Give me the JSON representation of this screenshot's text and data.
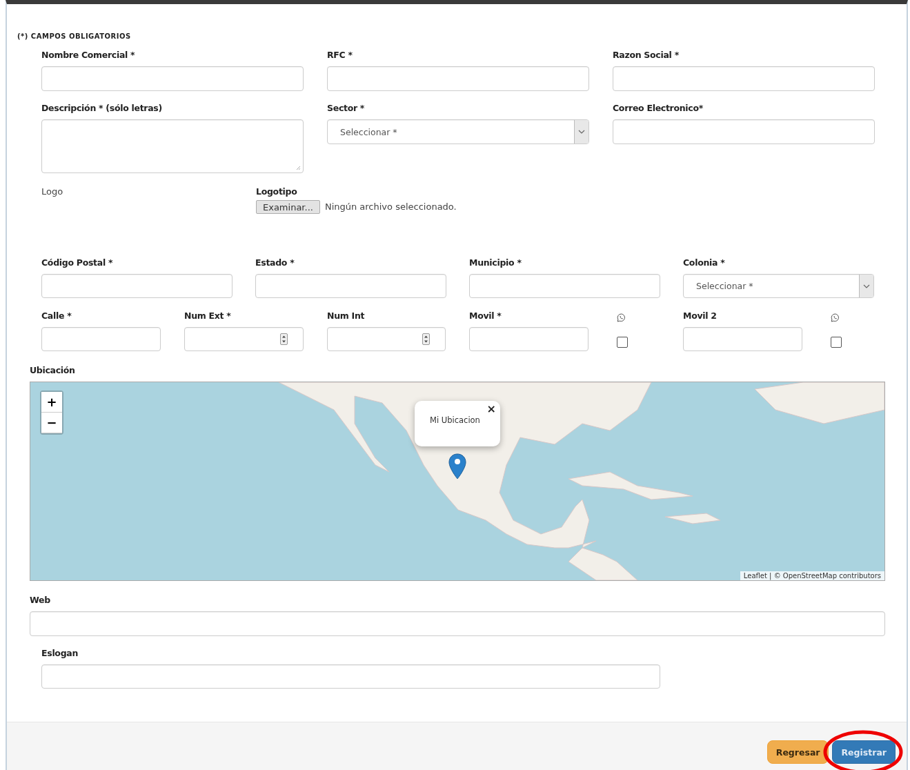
{
  "required_note": "(*) CAMPOS OBLIGATORIOS",
  "row_1": [
    {
      "label": "Nombre Comercial *",
      "kind": "text"
    },
    {
      "label": "RFC *",
      "kind": "text"
    },
    {
      "label": "Razon Social *",
      "kind": "text"
    }
  ],
  "row_2": [
    {
      "label": "Descripción * (sólo letras)",
      "kind": "textarea"
    },
    {
      "label": "Sector *",
      "kind": "select",
      "placeholder": "Seleccionar *"
    },
    {
      "label": "Correo Electronico*",
      "kind": "text"
    }
  ],
  "logo": {
    "label": "Logo",
    "file_label": "Logotipo",
    "button": "Examinar...",
    "status": "Ningún archivo seleccionado."
  },
  "row_3": [
    {
      "label": "Código Postal *",
      "kind": "text"
    },
    {
      "label": "Estado *",
      "kind": "text"
    },
    {
      "label": "Municipio *",
      "kind": "text"
    },
    {
      "label": "Colonia *",
      "kind": "select",
      "placeholder": "Seleccionar *"
    }
  ],
  "row_4": [
    {
      "label": "Calle *",
      "kind": "text"
    },
    {
      "label": "Num Ext *",
      "kind": "number"
    },
    {
      "label": "Num Int",
      "kind": "number"
    },
    {
      "label": "Movil *",
      "kind": "text"
    },
    {
      "kind": "whatsapp",
      "checked": false
    },
    {
      "label": "Movil 2",
      "kind": "text"
    },
    {
      "kind": "whatsapp",
      "checked": false
    }
  ],
  "map": {
    "label": "Ubicación",
    "zoom_in": "+",
    "zoom_out": "−",
    "popup": {
      "text": "Mi Ubicacion",
      "close": "×"
    },
    "attribution": "Leaflet | © OpenStreetMap contributors"
  },
  "web": {
    "label": "Web"
  },
  "slogan": {
    "label": "Eslogan"
  },
  "buttons": [
    {
      "label": "Regresar",
      "kind": "secondary",
      "highlighted": false
    },
    {
      "label": "Registrar",
      "kind": "primary",
      "highlighted": true
    }
  ]
}
